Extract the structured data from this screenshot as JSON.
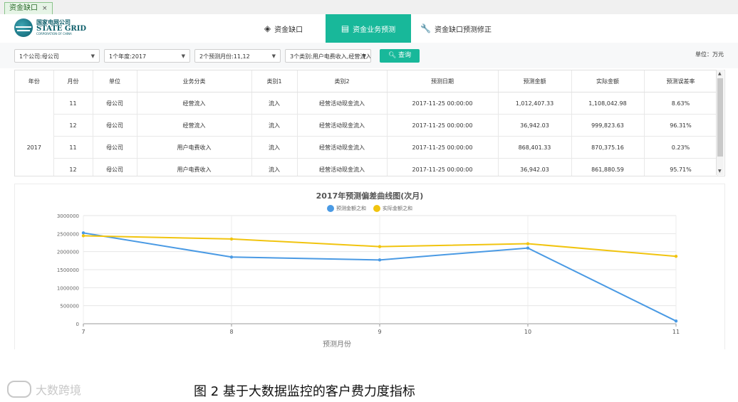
{
  "doc_tab": {
    "label": "资金缺口",
    "close": "×"
  },
  "logo": {
    "cn": "国家电网公司",
    "en": "STATE GRID",
    "sub": "CORPORATION OF CHINA"
  },
  "nav": [
    {
      "label": "资金缺口",
      "icon": "layers-icon"
    },
    {
      "label": "资金业务预测",
      "icon": "table-icon",
      "active": true
    },
    {
      "label": "资金缺口预测修正",
      "icon": "wrench-icon"
    }
  ],
  "filters": {
    "company": "1个公司:母公司",
    "year": "1个年度:2017",
    "months": "2个预测月份:11,12",
    "categories": "3个类别:用户电费收入,经营流入",
    "query_label": "查询",
    "unit": "单位：万元"
  },
  "table": {
    "columns": [
      "年份",
      "月份",
      "单位",
      "业务分类",
      "类别1",
      "类别2",
      "预测日期",
      "预测金额",
      "实际金额",
      "预测误差率"
    ],
    "year": "2017",
    "rows": [
      [
        "11",
        "母公司",
        "经营流入",
        "流入",
        "经营活动现金流入",
        "2017-11-25 00:00:00",
        "1,012,407.33",
        "1,108,042.98",
        "8.63%"
      ],
      [
        "12",
        "母公司",
        "经营流入",
        "流入",
        "经营活动现金流入",
        "2017-11-25 00:00:00",
        "36,942.03",
        "999,823.63",
        "96.31%"
      ],
      [
        "11",
        "母公司",
        "用户电费收入",
        "流入",
        "经营活动现金流入",
        "2017-11-25 00:00:00",
        "868,401.33",
        "870,375.16",
        "0.23%"
      ],
      [
        "12",
        "母公司",
        "用户电费收入",
        "流入",
        "经营活动现金流入",
        "2017-11-25 00:00:00",
        "36,942.03",
        "861,880.59",
        "95.71%"
      ]
    ]
  },
  "chart_data": {
    "type": "line",
    "title": "2017年预测偏差曲线图(次月)",
    "xlabel": "预测月份",
    "ylabel": "",
    "x": [
      7,
      8,
      9,
      10,
      11
    ],
    "ylim": [
      0,
      3000000
    ],
    "yticks": [
      0,
      500000,
      1000000,
      1500000,
      2000000,
      2500000,
      3000000
    ],
    "legend_position": "top",
    "grid": true,
    "series": [
      {
        "name": "预测金额之和",
        "color": "#4a9ae4",
        "values": [
          2520000,
          1850000,
          1770000,
          2100000,
          75000
        ]
      },
      {
        "name": "实际金额之和",
        "color": "#f1c40f",
        "values": [
          2440000,
          2350000,
          2140000,
          2220000,
          1870000
        ]
      }
    ]
  },
  "caption": "图 2  基于大数据监控的客户费力度指标",
  "watermark": "大数跨境"
}
